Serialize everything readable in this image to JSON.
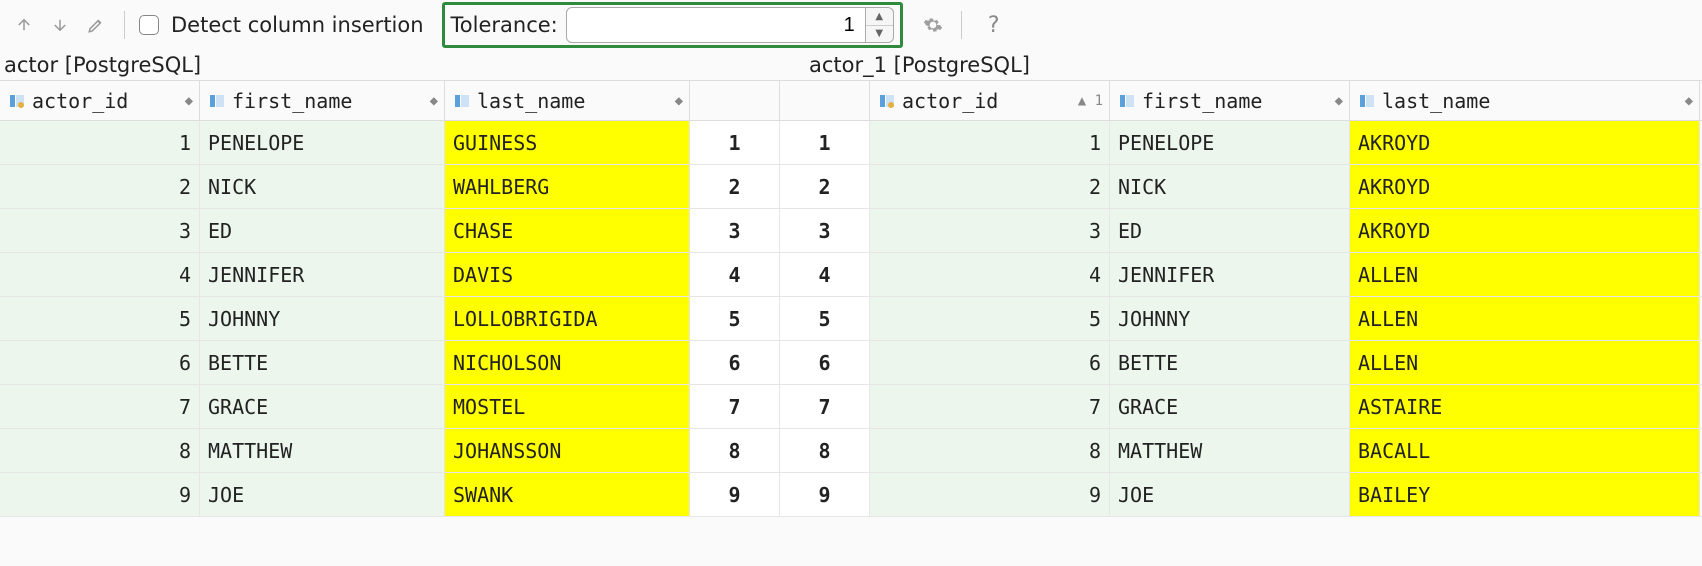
{
  "toolbar": {
    "detect_label": "Detect column insertion",
    "tolerance_label": "Tolerance:",
    "tolerance_value": "1"
  },
  "left": {
    "title": "actor [PostgreSQL]",
    "cols": [
      "actor_id",
      "first_name",
      "last_name"
    ],
    "rows": [
      {
        "id": "1",
        "fn": "PENELOPE",
        "ln": "GUINESS"
      },
      {
        "id": "2",
        "fn": "NICK",
        "ln": "WAHLBERG"
      },
      {
        "id": "3",
        "fn": "ED",
        "ln": "CHASE"
      },
      {
        "id": "4",
        "fn": "JENNIFER",
        "ln": "DAVIS"
      },
      {
        "id": "5",
        "fn": "JOHNNY",
        "ln": "LOLLOBRIGIDA"
      },
      {
        "id": "6",
        "fn": "BETTE",
        "ln": "NICHOLSON"
      },
      {
        "id": "7",
        "fn": "GRACE",
        "ln": "MOSTEL"
      },
      {
        "id": "8",
        "fn": "MATTHEW",
        "ln": "JOHANSSON"
      },
      {
        "id": "9",
        "fn": "JOE",
        "ln": "SWANK"
      }
    ]
  },
  "mid": {
    "left_nums": [
      "1",
      "2",
      "3",
      "4",
      "5",
      "6",
      "7",
      "8",
      "9"
    ],
    "right_nums": [
      "1",
      "2",
      "3",
      "4",
      "5",
      "6",
      "7",
      "8",
      "9"
    ]
  },
  "right": {
    "title": "actor_1 [PostgreSQL]",
    "cols": [
      "actor_id",
      "first_name",
      "last_name"
    ],
    "sort_index": "1",
    "rows": [
      {
        "id": "1",
        "fn": "PENELOPE",
        "ln": "AKROYD"
      },
      {
        "id": "2",
        "fn": "NICK",
        "ln": "AKROYD"
      },
      {
        "id": "3",
        "fn": "ED",
        "ln": "AKROYD"
      },
      {
        "id": "4",
        "fn": "JENNIFER",
        "ln": "ALLEN"
      },
      {
        "id": "5",
        "fn": "JOHNNY",
        "ln": "ALLEN"
      },
      {
        "id": "6",
        "fn": "BETTE",
        "ln": "ALLEN"
      },
      {
        "id": "7",
        "fn": "GRACE",
        "ln": "ASTAIRE"
      },
      {
        "id": "8",
        "fn": "MATTHEW",
        "ln": "BACALL"
      },
      {
        "id": "9",
        "fn": "JOE",
        "ln": "BAILEY"
      }
    ]
  }
}
